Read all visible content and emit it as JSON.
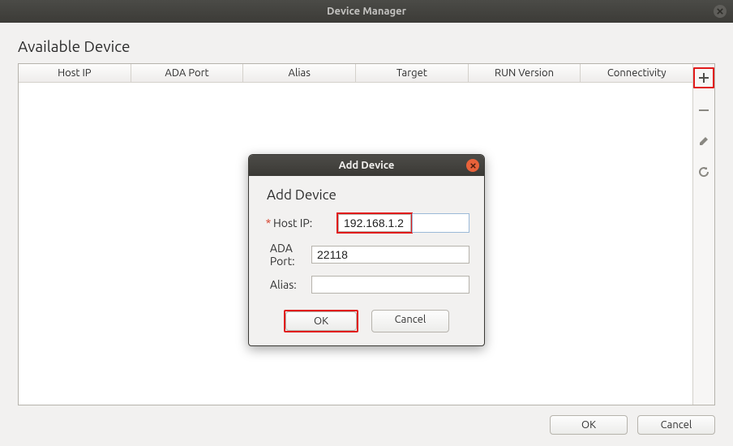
{
  "window": {
    "title": "Device Manager"
  },
  "main": {
    "section_title": "Available Device",
    "columns": [
      "Host IP",
      "ADA Port",
      "Alias",
      "Target",
      "RUN Version",
      "Connectivity"
    ],
    "buttons": {
      "ok": "OK",
      "cancel": "Cancel"
    }
  },
  "modal": {
    "title": "Add Device",
    "heading": "Add Device",
    "fields": {
      "hostip": {
        "label": "Host IP:",
        "required": "*",
        "value": "192.168.1.2"
      },
      "adaport": {
        "label": "ADA Port:",
        "value": "22118"
      },
      "alias": {
        "label": "Alias:",
        "value": ""
      }
    },
    "buttons": {
      "ok": "OK",
      "cancel": "Cancel"
    }
  }
}
